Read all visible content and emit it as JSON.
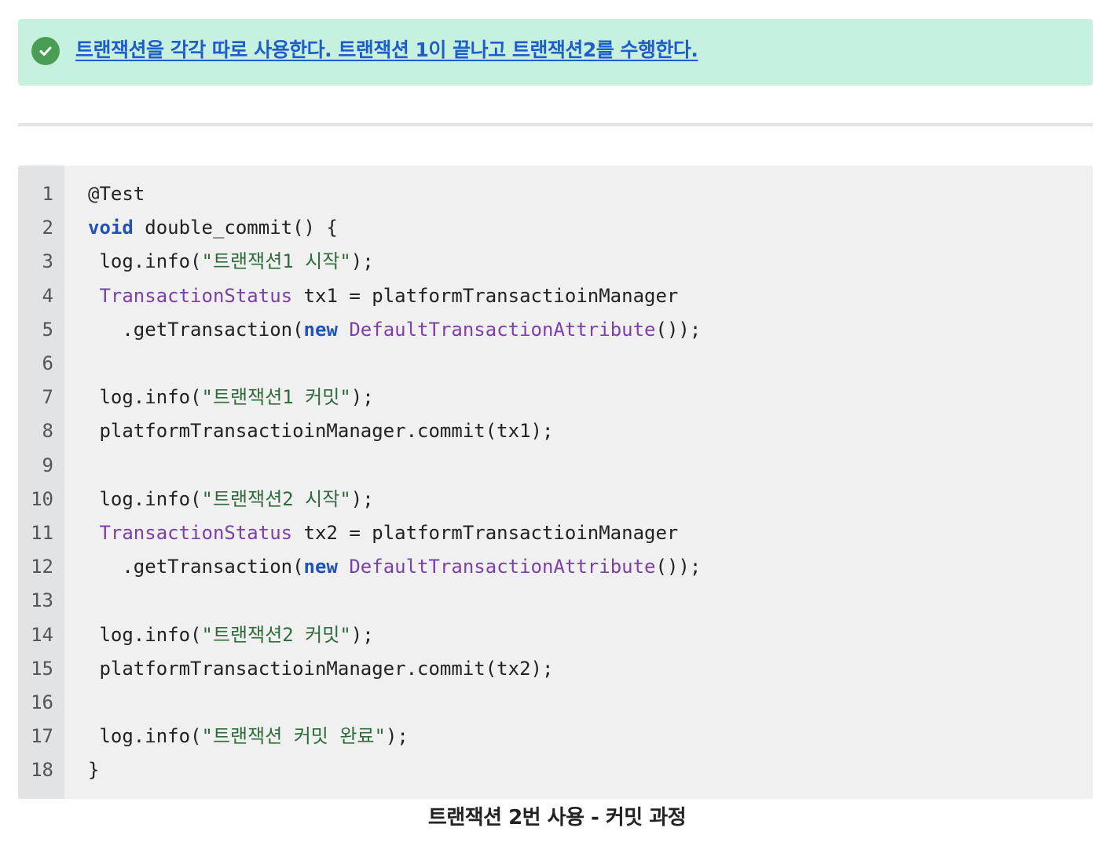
{
  "callout": {
    "icon": "check-circle-icon",
    "link_text": "트랜잭션을 각각 따로 사용한다. 트랜잭션 1이 끝나고 트랜잭션2를 수행한다.",
    "background_color": "#c5f1de",
    "icon_color": "#4a9d55",
    "link_color": "#1f5ec9"
  },
  "code": {
    "line_numbers": [
      "1",
      "2",
      "3",
      "4",
      "5",
      "6",
      "7",
      "8",
      "9",
      "10",
      "11",
      "12",
      "13",
      "14",
      "15",
      "16",
      "17",
      "18"
    ],
    "lines": [
      [
        {
          "t": "@Test",
          "c": "plain"
        }
      ],
      [
        {
          "t": "void",
          "c": "kw"
        },
        {
          "t": " double_commit() {",
          "c": "plain"
        }
      ],
      [
        {
          "t": " log.info(",
          "c": "plain"
        },
        {
          "t": "\"트랜잭션1 시작\"",
          "c": "str"
        },
        {
          "t": ");",
          "c": "plain"
        }
      ],
      [
        {
          "t": " ",
          "c": "plain"
        },
        {
          "t": "TransactionStatus",
          "c": "type"
        },
        {
          "t": " tx1 = platformTransactioinManager",
          "c": "plain"
        }
      ],
      [
        {
          "t": "   .getTransaction(",
          "c": "plain"
        },
        {
          "t": "new",
          "c": "kw"
        },
        {
          "t": " ",
          "c": "plain"
        },
        {
          "t": "DefaultTransactionAttribute",
          "c": "type"
        },
        {
          "t": "());",
          "c": "plain"
        }
      ],
      [],
      [
        {
          "t": " log.info(",
          "c": "plain"
        },
        {
          "t": "\"트랜잭션1 커밋\"",
          "c": "str"
        },
        {
          "t": ");",
          "c": "plain"
        }
      ],
      [
        {
          "t": " platformTransactioinManager.commit(tx1);",
          "c": "plain"
        }
      ],
      [],
      [
        {
          "t": " log.info(",
          "c": "plain"
        },
        {
          "t": "\"트랜잭션2 시작\"",
          "c": "str"
        },
        {
          "t": ");",
          "c": "plain"
        }
      ],
      [
        {
          "t": " ",
          "c": "plain"
        },
        {
          "t": "TransactionStatus",
          "c": "type"
        },
        {
          "t": " tx2 = platformTransactioinManager",
          "c": "plain"
        }
      ],
      [
        {
          "t": "   .getTransaction(",
          "c": "plain"
        },
        {
          "t": "new",
          "c": "kw"
        },
        {
          "t": " ",
          "c": "plain"
        },
        {
          "t": "DefaultTransactionAttribute",
          "c": "type"
        },
        {
          "t": "());",
          "c": "plain"
        }
      ],
      [],
      [
        {
          "t": " log.info(",
          "c": "plain"
        },
        {
          "t": "\"트랜잭션2 커밋\"",
          "c": "str"
        },
        {
          "t": ");",
          "c": "plain"
        }
      ],
      [
        {
          "t": " platformTransactioinManager.commit(tx2);",
          "c": "plain"
        }
      ],
      [],
      [
        {
          "t": " log.info(",
          "c": "plain"
        },
        {
          "t": "\"트랜잭션 커밋 완료\"",
          "c": "str"
        },
        {
          "t": ");",
          "c": "plain"
        }
      ],
      [
        {
          "t": "}",
          "c": "plain"
        }
      ]
    ],
    "colors": {
      "keyword": "#2052b8",
      "type": "#7d3fa8",
      "string": "#2f6b3a",
      "background": "#f0f0f0",
      "gutter": "#e2e3e4"
    }
  },
  "caption": "트랜잭션 2번 사용 - 커밋 과정"
}
